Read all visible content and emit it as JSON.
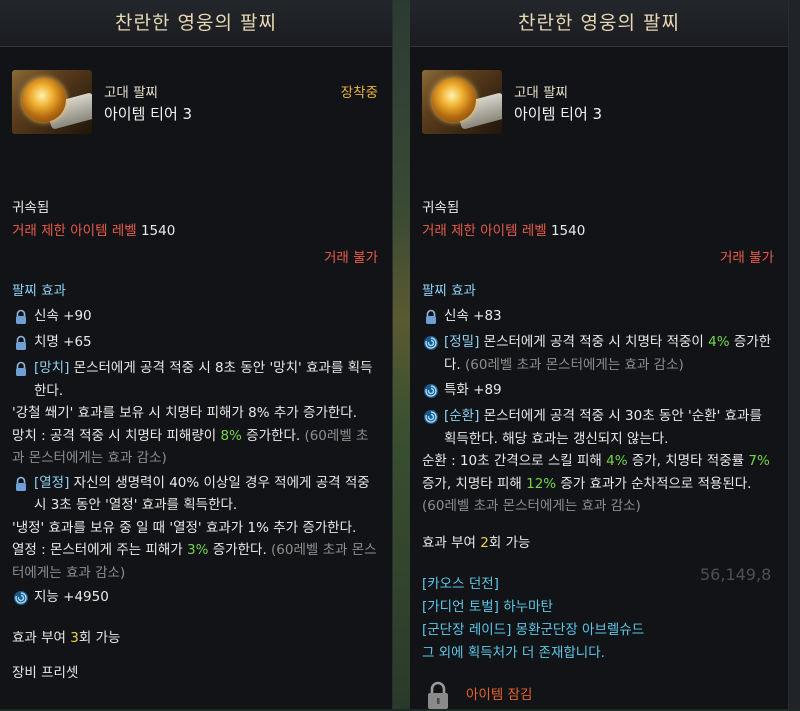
{
  "title": "찬란한 영웅의 팔찌",
  "left": {
    "grade": "고대 팔찌",
    "tier": "아이템 티어 3",
    "equipped": "장착중",
    "bound": "귀속됨",
    "trade_level_label": "거래 제한 아이템 레벨",
    "trade_level_value": "1540",
    "untradable": "거래 불가",
    "effects_title": "팔찌 효과",
    "stat1": "신속 +90",
    "stat2": "치명 +65",
    "e1_tag": "[망치]",
    "e1_text": " 몬스터에게 공격 적중 시 8초 동안 '망치' 효과를 획득한다.",
    "e1_text2": "'강철 쐐기' 효과를 보유 시 치명타 피해가 8% 추가 증가한다.",
    "e1_text3_a": "망치 : 공격 적중 시 치명타 피해량이 ",
    "e1_text3_pct": "8%",
    "e1_text3_b": " 증가한다. ",
    "e1_text3_note": "(60레벨 초과 몬스터에게는 효과 감소)",
    "e2_tag": "[열정]",
    "e2_text": " 자신의 생명력이 40% 이상일 경우 적에게 공격 적중 시 3초 동안 '열정' 효과를 획득한다.",
    "e2_text2": "'냉정' 효과를 보유 중 일 때 '열정' 효과가 1% 추가 증가한다.",
    "e2_text3_a": "열정 : 몬스터에게 주는 피해가 ",
    "e2_text3_pct": "3%",
    "e2_text3_b": " 증가한다. ",
    "e2_text3_note": "(60레벨 초과 몬스터에게는 효과 감소)",
    "stat3": "지능 +4950",
    "grant_a": "효과 부여 ",
    "grant_n": "3",
    "grant_b": "회 가능",
    "preset": "장비 프리셋"
  },
  "right": {
    "grade": "고대 팔찌",
    "tier": "아이템 티어 3",
    "bound": "귀속됨",
    "trade_level_label": "거래 제한 아이템 레벨",
    "trade_level_value": "1540",
    "untradable": "거래 불가",
    "effects_title": "팔찌 효과",
    "stat1": "신속 +83",
    "e1_tag": "[정밀]",
    "e1_text_a": " 몬스터에게 공격 적중 시 치명타 적중이 ",
    "e1_pct": "4%",
    "e1_text_b": " 증가한다. ",
    "e1_note": "(60레벨 초과 몬스터에게는 효과 감소)",
    "stat2": "특화 +89",
    "e2_tag": "[순환]",
    "e2_text": " 몬스터에게 공격 적중 시 30초 동안 '순환' 효과를 획득한다. 해당 효과는 갱신되지 않는다.",
    "e2_b_a": "순환 : 10초 간격으로 스킬 피해 ",
    "e2_b_p1": "4%",
    "e2_b_b": " 증가, 치명타 적중률 ",
    "e2_b_p2": "7%",
    "e2_b_c": " 증가, 치명타 피해 ",
    "e2_b_p3": "12%",
    "e2_b_d": " 증가 효과가 순차적으로 적용된다. ",
    "e2_b_note": "(60레벨 초과 몬스터에게는 효과 감소)",
    "grant_a": "효과 부여 ",
    "grant_n": "2",
    "grant_b": "회 가능",
    "src1": "[카오스 던전]",
    "src2": "[가디언 토벌] 하누마탄",
    "src3": "[군단장 레이드] 몽환군단장 아브렐슈드",
    "src4": "그 외에 획득처가 더 존재합니다.",
    "locked": "아이템 잠김"
  },
  "bg_text": "56,149,8",
  "colors": {
    "accent_gold": "#e8b43c",
    "trade_red": "#e85a4a",
    "section_blue": "#8ad0f2",
    "value_green": "#72d64a",
    "source_cyan": "#5cc8e8"
  },
  "icons": [
    "lock-icon",
    "swirl-icon",
    "item-thumbnail",
    "padlock-icon"
  ]
}
